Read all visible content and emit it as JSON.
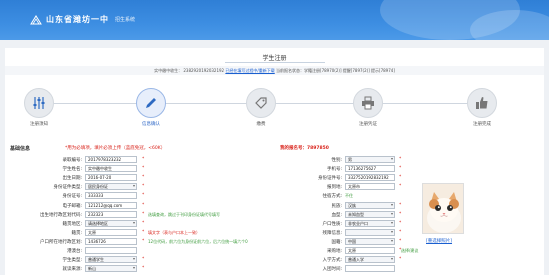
{
  "header": {
    "school_name": "山东省潍坊一中",
    "system_name": "招生系统"
  },
  "page": {
    "title": "学生注册",
    "info_prefix": "实中缴中收生：",
    "info_id": "2382920192032192",
    "info_link": "已经在填写过程中/重新下载",
    "info_suffix": "当前报名状态：学籍注册[78970(2)] 提醒[7897(2)]  提示[78974]"
  },
  "steps": [
    {
      "label": "注册须知",
      "icon": "sliders-icon"
    },
    {
      "label": "信息确认",
      "icon": "pencil-icon"
    },
    {
      "label": "缴费",
      "icon": "tag-icon"
    },
    {
      "label": "注册凭证",
      "icon": "printer-icon"
    },
    {
      "label": "注册完成",
      "icon": "thumbs-up-icon"
    }
  ],
  "form": {
    "section_label": "基础信息",
    "warning": "*用为必填项，填片必须上传（蓝底免冠，<60K）",
    "reg_number": "我的报名号：7897850",
    "left_fields": [
      {
        "label": "录取编号:",
        "value": "2017978323232",
        "type": "input",
        "required": true
      },
      {
        "label": "学生姓名:",
        "value": "实中缴中收生",
        "type": "input",
        "required": true
      },
      {
        "label": "出生日期:",
        "value": "2016-07-20",
        "type": "input",
        "required": true
      },
      {
        "label": "身份证件类型:",
        "value": "居民身份证",
        "type": "select",
        "required": true
      },
      {
        "label": "身份证号:",
        "value": "333333",
        "type": "input",
        "required": true
      },
      {
        "label": "电子邮箱:",
        "value": "121212@qq.com",
        "type": "input",
        "required": true
      },
      {
        "label": "出生地行政区划代码:",
        "value": "232323",
        "type": "input",
        "required": true,
        "hint": "选填查询，跳过于刊印身份证填代号填写"
      },
      {
        "label": "籍贯地区:",
        "value": "请选择地区",
        "type": "select",
        "required": true
      },
      {
        "label": "籍贯:",
        "value": "太原",
        "type": "input",
        "required": true,
        "hint": "填文字（表与户口本上一致）"
      },
      {
        "label": "户口所在地行政区划:",
        "value": "1436726",
        "type": "input",
        "required": true,
        "hint": "12位代码，前六位为身份证前六位，后六位统一填六个0"
      },
      {
        "label": "港澳台:",
        "value": "",
        "type": "input",
        "required": false
      },
      {
        "label": "学生类型:",
        "value": "普通学生",
        "type": "select",
        "required": true
      },
      {
        "label": "就读来源:",
        "value": "新山",
        "type": "select",
        "required": true
      }
    ],
    "right_fields": [
      {
        "label": "性别:",
        "value": "男",
        "type": "select",
        "required": true
      },
      {
        "label": "手机号:",
        "value": "17136275627",
        "type": "input",
        "required": true
      },
      {
        "label": "身份证件号:",
        "value": "3327520192832192",
        "type": "input",
        "required": true
      },
      {
        "label": "报到地:",
        "value": "太原市",
        "type": "input",
        "required": true
      },
      {
        "label": "住宿方式:",
        "value": "不住",
        "type": "text",
        "required": false
      },
      {
        "label": "民族:",
        "value": "汉族",
        "type": "select",
        "required": true
      },
      {
        "label": "血型:",
        "value": "未知血型",
        "type": "select",
        "required": true
      },
      {
        "label": "户口性质:",
        "value": "非农业户口",
        "type": "select",
        "required": true
      },
      {
        "label": "残障信息:",
        "value": "",
        "type": "select",
        "required": true
      },
      {
        "label": "国籍:",
        "value": "中国",
        "type": "select",
        "required": true
      },
      {
        "label": "采购地:",
        "value": "太原",
        "type": "input",
        "required": true,
        "hint": "选择/建议"
      },
      {
        "label": "入学方式:",
        "value": "普通入学",
        "type": "select",
        "required": true
      },
      {
        "label": "入团时间:",
        "value": "",
        "type": "input",
        "required": false
      }
    ],
    "photo_link": "[重选择照片]"
  },
  "colors": {
    "header_blue": "#3d8ee2",
    "required_red": "#d9231b",
    "hint_green": "#3b9a3b",
    "link_blue": "#1a5fd0"
  }
}
